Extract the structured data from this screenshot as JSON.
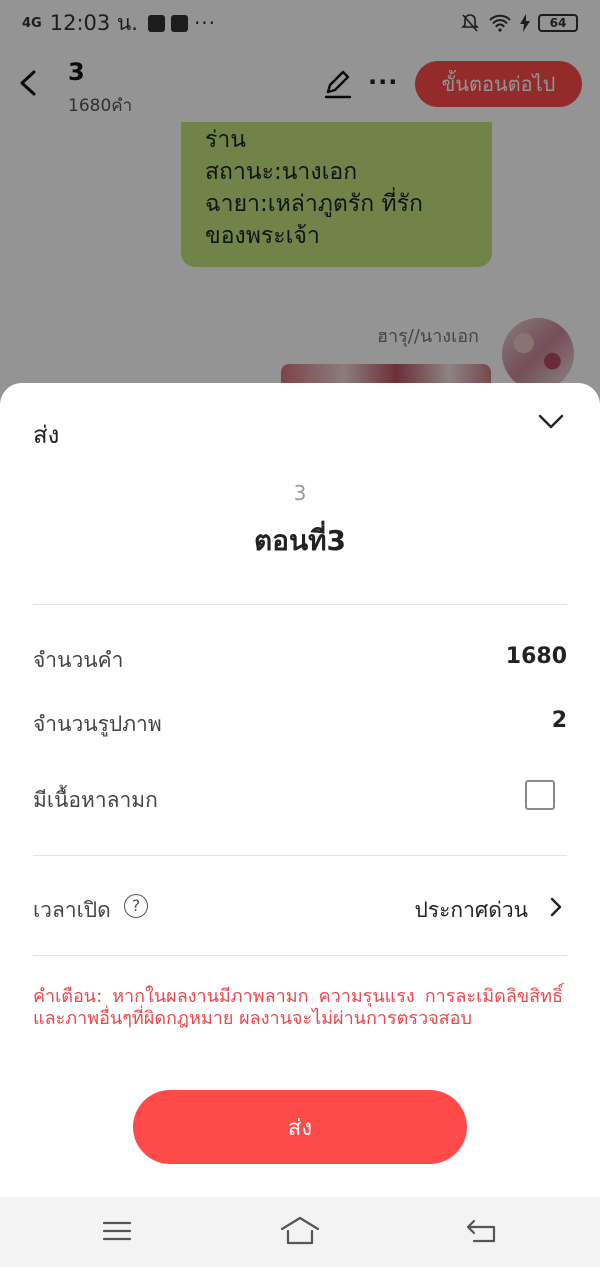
{
  "status_bar": {
    "network": "4G",
    "time": "12:03 น.",
    "battery": "64"
  },
  "header": {
    "title": "3",
    "word_count_subtitle": "1680คำ",
    "next_button_label": "ขั้นตอนต่อไป"
  },
  "chat": {
    "bubble_lines": [
      "ร่าน",
      "สถานะ:นางเอก",
      "ฉายา:เหล่าภูตรัก ที่รัก",
      "ของพระเจ้า"
    ],
    "sender_name": "ฮารุ//นางเอก"
  },
  "sheet": {
    "title": "ส่ง",
    "episode_number": "3",
    "episode_title": "ตอนที่3",
    "rows": {
      "word_count_label": "จำนวนคำ",
      "word_count_value": "1680",
      "image_count_label": "จำนวนรูปภาพ",
      "image_count_value": "2",
      "adult_content_label": "มีเนื้อหาลามก",
      "adult_content_checked": false,
      "open_time_label": "เวลาเปิด",
      "open_time_value": "ประกาศด่วน"
    },
    "warning": "คำเตือน: หากในผลงานมีภาพลามก ความรุนแรง การละเมิดลิขสิทธิ์และภาพอื่นๆที่ผิดกฎหมาย ผลงานจะไม่ผ่านการตรวจสอบ",
    "send_button_label": "ส่ง"
  },
  "colors": {
    "accent": "#ff4a4a",
    "warning_text": "#e8484f",
    "bubble": "#c2e480"
  },
  "icons": [
    "back-arrow-icon",
    "edit-pencil-icon",
    "more-icon",
    "chevron-down-icon",
    "help-icon",
    "chevron-right-icon",
    "menu-icon",
    "home-icon",
    "back-nav-icon"
  ]
}
